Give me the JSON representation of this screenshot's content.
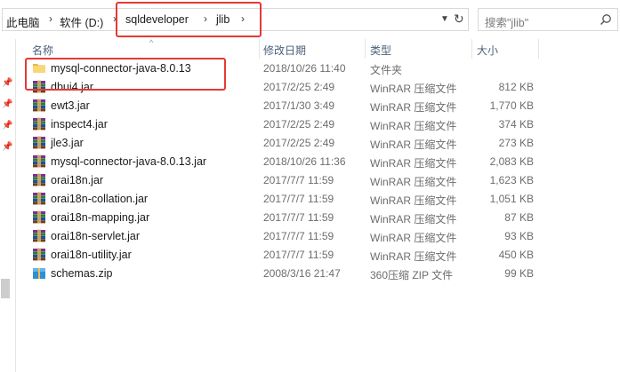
{
  "breadcrumb": {
    "items": [
      "此电脑",
      "软件 (D:)",
      "sqldeveloper",
      "jlib"
    ]
  },
  "search": {
    "placeholder": "搜索\"jlib\""
  },
  "columns": {
    "name": "名称",
    "modified": "修改日期",
    "type": "类型",
    "size": "大小"
  },
  "files": [
    {
      "name": "mysql-connector-java-8.0.13",
      "modified": "2018/10/26 11:40",
      "type": "文件夹",
      "size": "",
      "icon": "folder-icon"
    },
    {
      "name": "dbui4.jar",
      "modified": "2017/2/25 2:49",
      "type": "WinRAR 压缩文件",
      "size": "812 KB",
      "icon": "winrar-archive-icon"
    },
    {
      "name": "ewt3.jar",
      "modified": "2017/1/30 3:49",
      "type": "WinRAR 压缩文件",
      "size": "1,770 KB",
      "icon": "winrar-archive-icon"
    },
    {
      "name": "inspect4.jar",
      "modified": "2017/2/25 2:49",
      "type": "WinRAR 压缩文件",
      "size": "374 KB",
      "icon": "winrar-archive-icon"
    },
    {
      "name": "jle3.jar",
      "modified": "2017/2/25 2:49",
      "type": "WinRAR 压缩文件",
      "size": "273 KB",
      "icon": "winrar-archive-icon"
    },
    {
      "name": "mysql-connector-java-8.0.13.jar",
      "modified": "2018/10/26 11:36",
      "type": "WinRAR 压缩文件",
      "size": "2,083 KB",
      "icon": "winrar-archive-icon"
    },
    {
      "name": "orai18n.jar",
      "modified": "2017/7/7 11:59",
      "type": "WinRAR 压缩文件",
      "size": "1,623 KB",
      "icon": "winrar-archive-icon"
    },
    {
      "name": "orai18n-collation.jar",
      "modified": "2017/7/7 11:59",
      "type": "WinRAR 压缩文件",
      "size": "1,051 KB",
      "icon": "winrar-archive-icon"
    },
    {
      "name": "orai18n-mapping.jar",
      "modified": "2017/7/7 11:59",
      "type": "WinRAR 压缩文件",
      "size": "87 KB",
      "icon": "winrar-archive-icon"
    },
    {
      "name": "orai18n-servlet.jar",
      "modified": "2017/7/7 11:59",
      "type": "WinRAR 压缩文件",
      "size": "93 KB",
      "icon": "winrar-archive-icon"
    },
    {
      "name": "orai18n-utility.jar",
      "modified": "2017/7/7 11:59",
      "type": "WinRAR 压缩文件",
      "size": "450 KB",
      "icon": "winrar-archive-icon"
    },
    {
      "name": "schemas.zip",
      "modified": "2008/3/16 21:47",
      "type": "360压缩 ZIP 文件",
      "size": "99 KB",
      "icon": "zip-archive-icon"
    }
  ],
  "colors": {
    "highlight": "#e53935",
    "header_text": "#4c607a",
    "folder": "#f8d775"
  }
}
